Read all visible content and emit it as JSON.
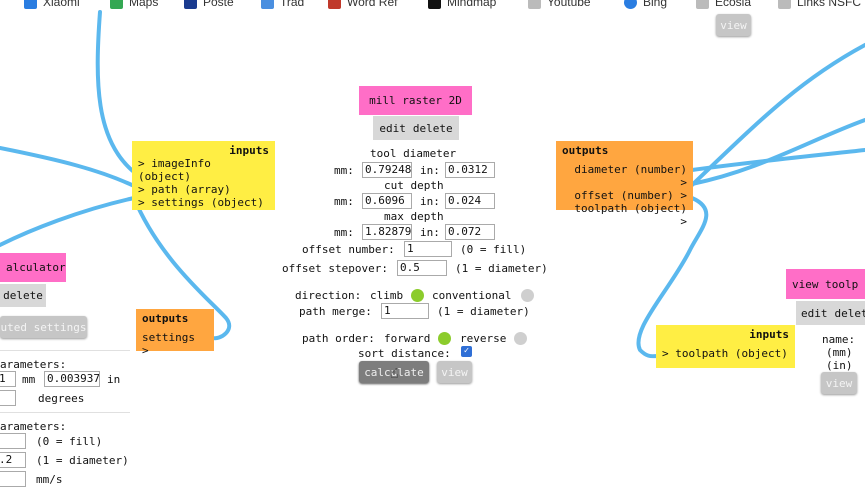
{
  "bookmarks": [
    {
      "label": "Xiaomi",
      "color": "#2a7de1"
    },
    {
      "label": "Maps",
      "color": "#34a853"
    },
    {
      "label": "Poste",
      "color": "#1a3b8f"
    },
    {
      "label": "Trad",
      "color": "#4a8fe0"
    },
    {
      "label": "Word Ref",
      "color": "#c0392b"
    },
    {
      "label": "Mindmap",
      "color": "#111111"
    },
    {
      "label": "Youtube",
      "color": "#bbbbbb"
    },
    {
      "label": "Bing",
      "color": "#2a7de1"
    },
    {
      "label": "Ecosia",
      "color": "#bbbbbb"
    },
    {
      "label": "Links NSFC",
      "color": "#bbbbbb"
    }
  ],
  "top_view_label": "view",
  "left_inputs": {
    "title": "inputs",
    "rows": [
      "> imageInfo (object)",
      "> path (array)",
      "> settings (object)"
    ]
  },
  "left_calc": {
    "title": "alculator",
    "delete_label": "delete",
    "settings_btn": "uted settings",
    "outputs_title": "outputs",
    "outputs_row": "settings >",
    "params1_title": "arameters:",
    "row1_mm_value": "1",
    "row1_mm_unit": "mm",
    "row1_in_value": "0.003937",
    "row1_in_unit": "in",
    "row2_unit": "degrees",
    "params2_title": "arameters:",
    "row3_note": "(0 = fill)",
    "row4_value": ".2",
    "row4_note": "(1 = diameter)",
    "row5_unit": "mm/s"
  },
  "mill": {
    "title": "mill raster 2D",
    "edit_label": "edit",
    "delete_label": "delete",
    "tool_diameter": "tool diameter",
    "mm": "mm:",
    "in": "in:",
    "td_mm": "0.79248",
    "td_in": "0.0312",
    "cut_depth": "cut depth",
    "cd_mm": "0.6096",
    "cd_in": "0.024",
    "max_depth": "max depth",
    "md_mm": "1.82879",
    "md_in": "0.072",
    "offset_number_label": "offset number:",
    "offset_number": "1",
    "offset_number_note": "(0 = fill)",
    "offset_stepover_label": "offset stepover:",
    "offset_stepover": "0.5",
    "offset_stepover_note": "(1 = diameter)",
    "direction_label": "direction:",
    "climb": "climb",
    "conventional": "conventional",
    "path_merge_label": "path merge:",
    "path_merge": "1",
    "path_merge_note": "(1 = diameter)",
    "path_order_label": "path order:",
    "forward": "forward",
    "reverse": "reverse",
    "sort_distance_label": "sort distance:",
    "calculate_label": "calculate",
    "view_label": "view"
  },
  "mill_outputs": {
    "title": "outputs",
    "rows": [
      "diameter (number) >",
      "offset (number) >",
      "toolpath (object) >"
    ]
  },
  "right_inputs": {
    "title": "inputs",
    "rows": [
      "> toolpath (object)"
    ]
  },
  "view_toolpath": {
    "title": "view toolp",
    "edit_label": "edit",
    "delete_label": "delet",
    "name_label": "name:",
    "mm_label": "(mm)",
    "in_label": "(in)",
    "view_label": "view"
  },
  "colors": {
    "wire": "#5bb8ee",
    "pink": "#ff6ec7",
    "yellow": "#ffee44",
    "orange": "#ffa640",
    "green_dot": "#8ccc2c"
  }
}
